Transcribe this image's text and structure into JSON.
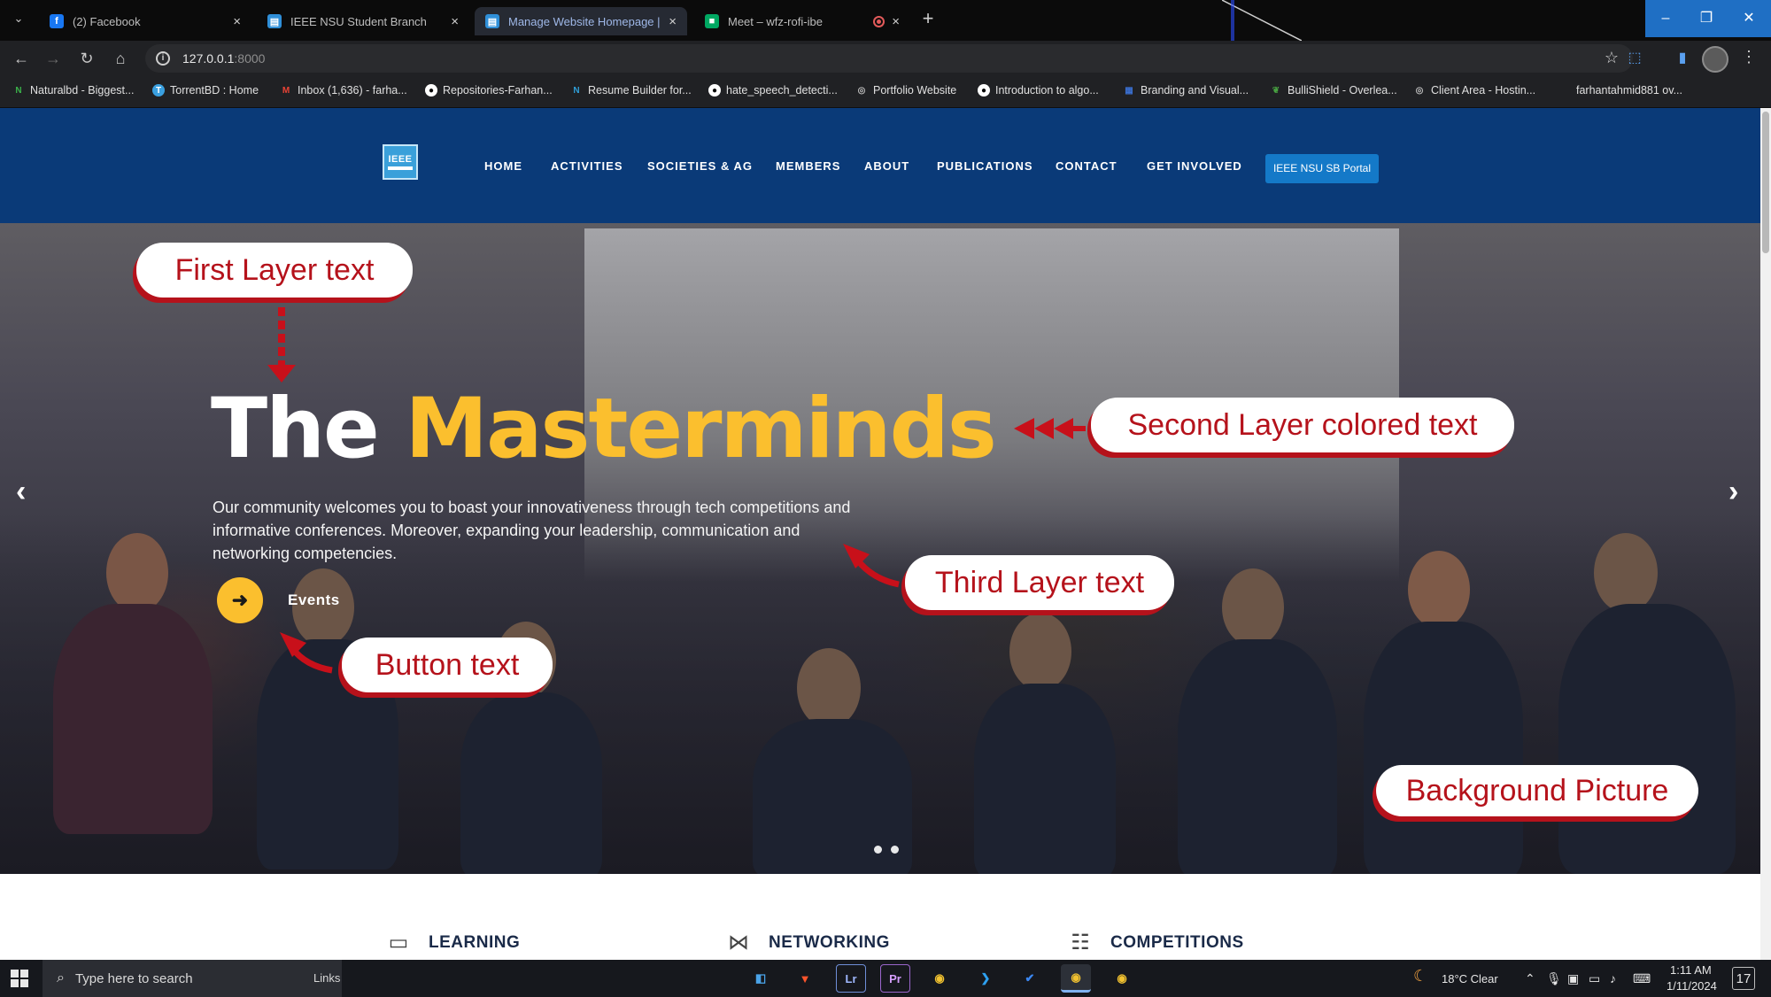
{
  "browser": {
    "tabs": [
      {
        "title": "(2) Facebook",
        "favicon": "facebook-icon",
        "color": "#1877f2",
        "glyph": "f"
      },
      {
        "title": "IEEE NSU Student Branch",
        "favicon": "ieee-favicon-icon",
        "color": "#2f8fd8",
        "glyph": "▤"
      },
      {
        "title": "Manage Website Homepage | I",
        "favicon": "ieee-favicon-icon",
        "color": "#2f8fd8",
        "glyph": "▤"
      },
      {
        "title": "Meet – wfz-rofi-ibe",
        "favicon": "google-meet-icon",
        "color": "#00a862",
        "glyph": "■"
      }
    ],
    "address": {
      "host": "127.0.0.1",
      "port": ":8000"
    },
    "bookmarks": [
      {
        "label": "Naturalbd - Biggest...",
        "icon": "naturalbd-icon",
        "color": "#3bb34a",
        "glyph": "N"
      },
      {
        "label": "TorrentBD : Home",
        "icon": "torrentbd-icon",
        "color": "#3aa0e0",
        "glyph": "T"
      },
      {
        "label": "Inbox (1,636) - farha...",
        "icon": "gmail-icon",
        "color": "#ea4335",
        "glyph": "M"
      },
      {
        "label": "Repositories-Farhan...",
        "icon": "github-icon",
        "color": "#ffffff",
        "glyph": "●"
      },
      {
        "label": "Resume Builder for...",
        "icon": "resume-builder-icon",
        "color": "#2f9fd8",
        "glyph": "N"
      },
      {
        "label": "hate_speech_detecti...",
        "icon": "github-icon",
        "color": "#ffffff",
        "glyph": "●"
      },
      {
        "label": "Portfolio Website",
        "icon": "globe-icon",
        "color": "#bdbdbd",
        "glyph": "◎"
      },
      {
        "label": "Introduction to algo...",
        "icon": "github-icon",
        "color": "#ffffff",
        "glyph": "●"
      },
      {
        "label": "Branding and Visual...",
        "icon": "ieee-favicon-icon",
        "color": "#3a6fd0",
        "glyph": "▦"
      },
      {
        "label": "BulliShield - Overlea...",
        "icon": "overleaf-icon",
        "color": "#47a141",
        "glyph": "❦"
      },
      {
        "label": "Client Area - Hostin...",
        "icon": "globe-icon",
        "color": "#bdbdbd",
        "glyph": "◎"
      },
      {
        "label": "farhantahmid881 ov...",
        "icon": "",
        "color": "#bdbdbd",
        "glyph": ""
      }
    ]
  },
  "site": {
    "logo_text": "IEEE",
    "nav": [
      "HOME",
      "ACTIVITIES",
      "SOCIETIES & AG",
      "MEMBERS",
      "ABOUT",
      "PUBLICATIONS",
      "CONTACT",
      "GET INVOLVED"
    ],
    "portal_button": "IEEE NSU SB Portal",
    "hero": {
      "title_first": "The",
      "title_second": "Masterminds",
      "description": "Our community welcomes you to boast your innovativeness through tech competitions and informative conferences. Moreover, expanding your leadership, communication and networking competencies.",
      "button_label": "Events",
      "prev": "‹",
      "next": "›"
    },
    "annotations": {
      "first_layer": "First Layer text",
      "second_layer": "Second Layer colored text",
      "third_layer": "Third Layer text",
      "button_text": "Button text",
      "background": "Background Picture"
    },
    "features": [
      "LEARNING",
      "NETWORKING",
      "COMPETITIONS"
    ]
  },
  "taskbar": {
    "search_placeholder": "Type here to search",
    "links_label": "Links",
    "weather": "18°C  Clear",
    "time": "1:11 AM",
    "date": "1/11/2024",
    "notifications": "17"
  },
  "colors": {
    "site_nav": "#0a3a78",
    "accent_gold": "#fbbf2e",
    "annotation_red": "#b5121b",
    "portal_blue": "#1479c8"
  }
}
